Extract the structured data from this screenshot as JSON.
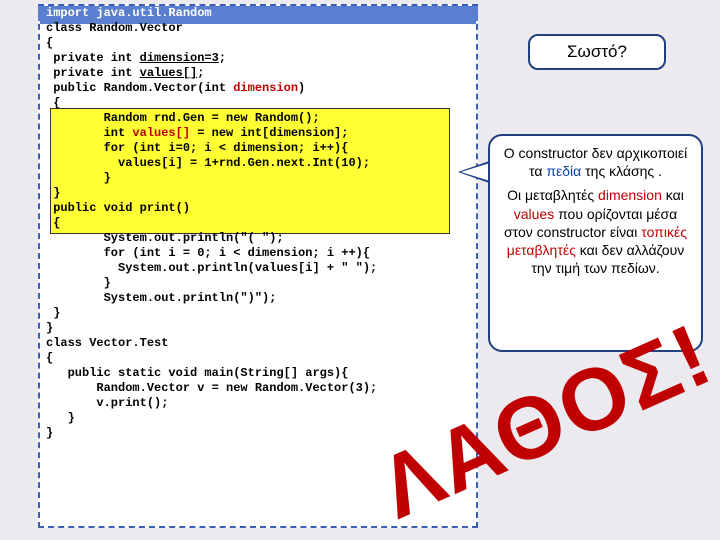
{
  "callouts": {
    "correct": "Σωστό?",
    "main": {
      "p1_a": "O constructor δεν αρχικοποιεί τα ",
      "p1_b": "πεδία",
      "p1_c": " της κλάσης .",
      "p2_a": "Οι μεταβλητές ",
      "p2_dim": "dimension",
      "p2_b": " και ",
      "p2_val": "values",
      "p2_c": " που ορίζονται μέσα στον constructor είναι ",
      "p2_local": "τοπικές μεταβλητές",
      "p2_d": " και δεν αλλάζουν την τιμή των πεδίων."
    }
  },
  "stamp": "ΛΑΘΟΣ!",
  "code": {
    "l01": "import java.util.Random",
    "l02": "",
    "l03": "class Random.Vector",
    "l04": "{",
    "l05a": " private int ",
    "l05b": "dimension=3",
    "l05c": ";",
    "l06a": " private int ",
    "l06b": "values[]",
    "l06c": ";",
    "l07": "",
    "l08a": " public Random.Vector(int ",
    "l08b": "dimension",
    "l08c": ")",
    "l09": " {",
    "l10": "        Random rnd.Gen = new Random();",
    "l11a": "        int ",
    "l11b": "values[]",
    "l11c": " = new int[dimension];",
    "l12": "        for (int i=0; i < dimension; i++){",
    "l13": "          values[i] = 1+rnd.Gen.next.Int(10);",
    "l14": "        }",
    "l15": " }",
    "l16": "",
    "l17": " public void print()",
    "l18": " {",
    "l19": "        System.out.println(\"( \");",
    "l20": "        for (int i = 0; i < dimension; i ++){",
    "l21": "          System.out.println(values[i] + \" \");",
    "l22": "        }",
    "l23": "        System.out.println(\")\");",
    "l24": "",
    "l25": " }",
    "l26": "}",
    "l27": "",
    "l28": "class Vector.Test",
    "l29": "{",
    "l30": "   public static void main(String[] args){",
    "l31": "       Random.Vector v = new Random.Vector(3);",
    "l32": "       v.print();",
    "l33": "   }",
    "l34": "}"
  }
}
